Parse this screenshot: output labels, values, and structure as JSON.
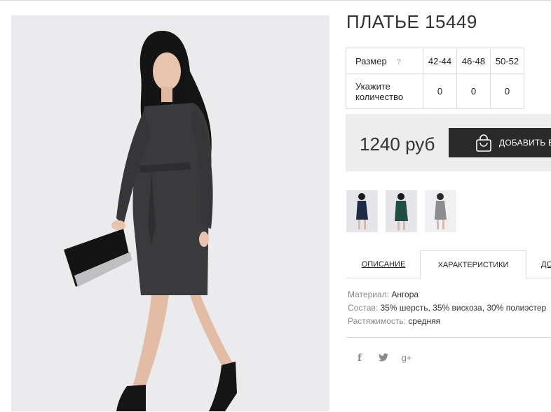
{
  "product": {
    "title": "ПЛАТЬЕ 15449",
    "image_alt": "woman in dark grey dress with belt holding a black and snakeskin clutch"
  },
  "sizes_table": {
    "size_label": "Размер",
    "help_icon": "?",
    "sizes": [
      "42-44",
      "46-48",
      "50-52"
    ],
    "quantity_label_line1": "Укажите",
    "quantity_label_line2": "количество",
    "quantities": [
      "0",
      "0",
      "0"
    ]
  },
  "buy": {
    "price": "1240 руб",
    "add_to_cart_label": "ДОБАВИТЬ В",
    "cart_icon": "shopping-bag-icon"
  },
  "thumbnails": [
    {
      "name": "navy dress variant",
      "dress_color": "#1f2a44"
    },
    {
      "name": "green dress variant",
      "dress_color": "#1f4f44"
    },
    {
      "name": "grey dress variant",
      "dress_color": "#8d8d8f"
    }
  ],
  "tabs": [
    "ОПИСАНИЕ",
    "ХАРАКТЕРИСТИКИ",
    "ДО"
  ],
  "specs": [
    {
      "key": "Материал:",
      "value": "Ангора"
    },
    {
      "key": "Состав:",
      "value": "35% шерсть, 35% вискоза, 30% полиэстер"
    },
    {
      "key": "Растяжимость:",
      "value": "средняя"
    }
  ],
  "social": [
    {
      "icon": "facebook-icon",
      "glyph": "f"
    },
    {
      "icon": "twitter-icon",
      "glyph": "t"
    },
    {
      "icon": "google-plus-icon",
      "glyph": "g+"
    }
  ],
  "colors": {
    "button_bg": "#2a2a2a",
    "buybox_bg": "#ededed",
    "border": "#dcdcdc",
    "image_bg": "#ebebed"
  }
}
